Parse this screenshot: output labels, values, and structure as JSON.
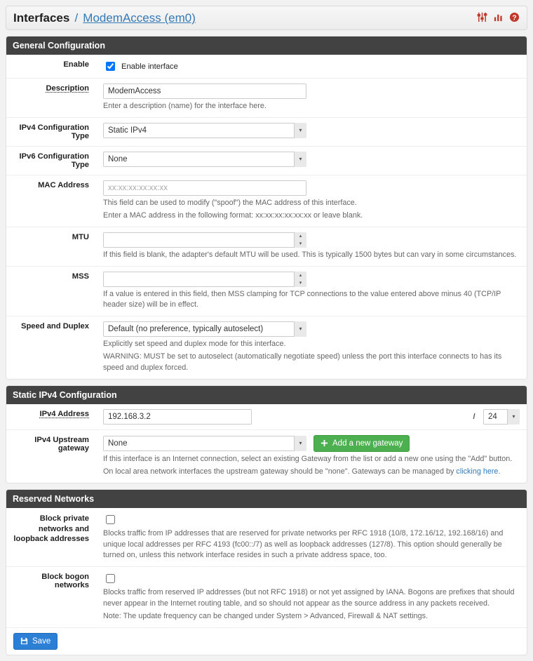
{
  "breadcrumb": {
    "root": "Interfaces",
    "leaf": "ModemAccess (em0)"
  },
  "sections": {
    "general": {
      "title": "General Configuration",
      "enable": {
        "label": "Enable",
        "checkbox_label": "Enable interface",
        "checked": true
      },
      "description": {
        "label": "Description",
        "value": "ModemAccess",
        "help": "Enter a description (name) for the interface here."
      },
      "ipv4type": {
        "label": "IPv4 Configuration Type",
        "value": "Static IPv4"
      },
      "ipv6type": {
        "label": "IPv6 Configuration Type",
        "value": "None"
      },
      "mac": {
        "label": "MAC Address",
        "placeholder": "xx:xx:xx:xx:xx:xx",
        "help1": "This field can be used to modify (\"spoof\") the MAC address of this interface.",
        "help2": "Enter a MAC address in the following format: xx:xx:xx:xx:xx:xx or leave blank."
      },
      "mtu": {
        "label": "MTU",
        "help": "If this field is blank, the adapter's default MTU will be used. This is typically 1500 bytes but can vary in some circumstances."
      },
      "mss": {
        "label": "MSS",
        "help": "If a value is entered in this field, then MSS clamping for TCP connections to the value entered above minus 40 (TCP/IP header size) will be in effect."
      },
      "speed": {
        "label": "Speed and Duplex",
        "value": "Default (no preference, typically autoselect)",
        "help1": "Explicitly set speed and duplex mode for this interface.",
        "help2": "WARNING: MUST be set to autoselect (automatically negotiate speed) unless the port this interface connects to has its speed and duplex forced."
      }
    },
    "staticv4": {
      "title": "Static IPv4 Configuration",
      "address": {
        "label": "IPv4 Address",
        "value": "192.168.3.2",
        "slash": "/",
        "cidr": "24"
      },
      "gateway": {
        "label": "IPv4 Upstream gateway",
        "value": "None",
        "add_label": "Add a new gateway",
        "help1": "If this interface is an Internet connection, select an existing Gateway from the list or add a new one using the \"Add\" button.",
        "help2a": "On local area network interfaces the upstream gateway should be \"none\". Gateways can be managed by ",
        "help2link": "clicking here",
        "help2b": "."
      }
    },
    "reserved": {
      "title": "Reserved Networks",
      "private": {
        "label": "Block private networks and loopback addresses",
        "help": "Blocks traffic from IP addresses that are reserved for private networks per RFC 1918 (10/8, 172.16/12, 192.168/16) and unique local addresses per RFC 4193 (fc00::/7) as well as loopback addresses (127/8). This option should generally be turned on, unless this network interface resides in such a private address space, too."
      },
      "bogon": {
        "label": "Block bogon networks",
        "help1": "Blocks traffic from reserved IP addresses (but not RFC 1918) or not yet assigned by IANA. Bogons are prefixes that should never appear in the Internet routing table, and so should not appear as the source address in any packets received.",
        "help2": "Note: The update frequency can be changed under System > Advanced, Firewall & NAT settings."
      }
    }
  },
  "buttons": {
    "save": "Save"
  }
}
